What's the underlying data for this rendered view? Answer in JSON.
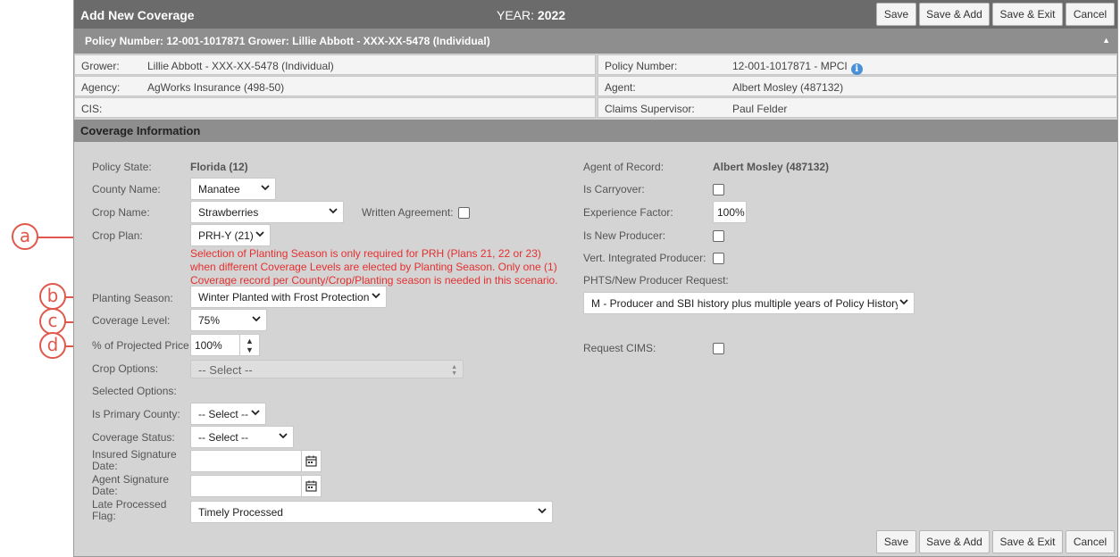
{
  "callouts": [
    "a",
    "b",
    "c",
    "d"
  ],
  "header": {
    "title": "Add New Coverage",
    "year_label": "YEAR:",
    "year_value": "2022",
    "buttons": {
      "save": "Save",
      "save_add": "Save & Add",
      "save_exit": "Save & Exit",
      "cancel": "Cancel"
    }
  },
  "policy_bar": {
    "text": "Policy Number: 12-001-1017871 Grower: Lillie Abbott - XXX-XX-5478 (Individual)",
    "caret": "▲"
  },
  "info": {
    "grower_label": "Grower:",
    "grower_value": "Lillie Abbott - XXX-XX-5478 (Individual)",
    "policy_number_label": "Policy Number:",
    "policy_number_value": "12-001-1017871 - MPCI",
    "agency_label": "Agency:",
    "agency_value": "AgWorks Insurance (498-50)",
    "agent_label": "Agent:",
    "agent_value": "Albert Mosley (487132)",
    "cis_label": "CIS:",
    "claims_label": "Claims Supervisor:",
    "claims_value": "Paul Felder"
  },
  "section": {
    "title": "Coverage Information"
  },
  "form": {
    "policy_state_label": "Policy State:",
    "policy_state_value": "Florida (12)",
    "county_label": "County Name:",
    "county_value": "Manatee",
    "crop_label": "Crop Name:",
    "crop_value": "Strawberries",
    "written_agreement_label": "Written Agreement:",
    "crop_plan_label": "Crop Plan:",
    "crop_plan_value": "PRH-Y (21)",
    "warning": "Selection of Planting Season is only required for PRH (Plans 21, 22 or 23) when different Coverage Levels are elected by Planting Season. Only one (1) Coverage record per County/Crop/Planting season is needed in this scenario.",
    "planting_season_label": "Planting Season:",
    "planting_season_value": "Winter Planted with Frost Protection",
    "coverage_level_label": "Coverage Level:",
    "coverage_level_value": "75%",
    "projected_price_label": "% of Projected Price",
    "projected_price_value": "100%",
    "crop_options_label": "Crop Options:",
    "crop_options_value": "-- Select --",
    "selected_options_label": "Selected Options:",
    "primary_county_label": "Is Primary County:",
    "primary_county_value": "-- Select --",
    "coverage_status_label": "Coverage Status:",
    "coverage_status_value": "-- Select --",
    "insured_sig_label_1": "Insured Signature",
    "insured_sig_label_2": "Date:",
    "agent_sig_label_1": "Agent Signature",
    "agent_sig_label_2": "Date:",
    "late_flag_label_1": "Late Processed",
    "late_flag_label_2": "Flag:",
    "late_flag_value": "Timely Processed",
    "agent_of_record_label": "Agent of Record:",
    "agent_of_record_value": "Albert Mosley (487132)",
    "carryover_label": "Is Carryover:",
    "experience_label": "Experience Factor:",
    "experience_value": "100%",
    "new_producer_label": "Is New Producer:",
    "vert_integrated_label": "Vert. Integrated Producer:",
    "phts_label": "PHTS/New Producer Request:",
    "phts_value": "M - Producer and SBI history plus multiple years of Policy History",
    "cims_label": "Request CIMS:"
  },
  "colors": {
    "callout": "#e0584c",
    "warning": "#e53030",
    "titlebar": "#6b6b6b",
    "sectionbar": "#8e8e8e",
    "panel": "#d4d4d4"
  }
}
